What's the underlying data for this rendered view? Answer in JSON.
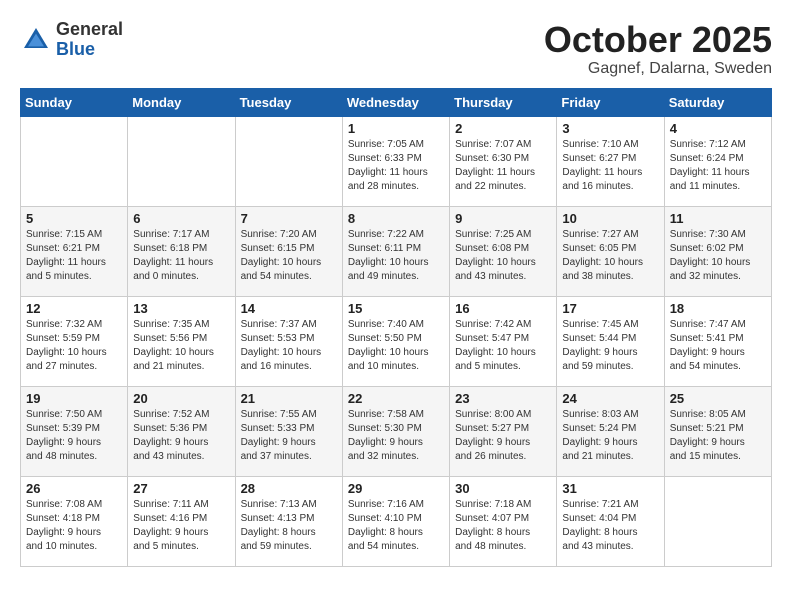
{
  "header": {
    "logo_line1": "General",
    "logo_line2": "Blue",
    "month": "October 2025",
    "location": "Gagnef, Dalarna, Sweden"
  },
  "weekdays": [
    "Sunday",
    "Monday",
    "Tuesday",
    "Wednesday",
    "Thursday",
    "Friday",
    "Saturday"
  ],
  "weeks": [
    [
      {
        "num": "",
        "info": ""
      },
      {
        "num": "",
        "info": ""
      },
      {
        "num": "",
        "info": ""
      },
      {
        "num": "1",
        "info": "Sunrise: 7:05 AM\nSunset: 6:33 PM\nDaylight: 11 hours\nand 28 minutes."
      },
      {
        "num": "2",
        "info": "Sunrise: 7:07 AM\nSunset: 6:30 PM\nDaylight: 11 hours\nand 22 minutes."
      },
      {
        "num": "3",
        "info": "Sunrise: 7:10 AM\nSunset: 6:27 PM\nDaylight: 11 hours\nand 16 minutes."
      },
      {
        "num": "4",
        "info": "Sunrise: 7:12 AM\nSunset: 6:24 PM\nDaylight: 11 hours\nand 11 minutes."
      }
    ],
    [
      {
        "num": "5",
        "info": "Sunrise: 7:15 AM\nSunset: 6:21 PM\nDaylight: 11 hours\nand 5 minutes."
      },
      {
        "num": "6",
        "info": "Sunrise: 7:17 AM\nSunset: 6:18 PM\nDaylight: 11 hours\nand 0 minutes."
      },
      {
        "num": "7",
        "info": "Sunrise: 7:20 AM\nSunset: 6:15 PM\nDaylight: 10 hours\nand 54 minutes."
      },
      {
        "num": "8",
        "info": "Sunrise: 7:22 AM\nSunset: 6:11 PM\nDaylight: 10 hours\nand 49 minutes."
      },
      {
        "num": "9",
        "info": "Sunrise: 7:25 AM\nSunset: 6:08 PM\nDaylight: 10 hours\nand 43 minutes."
      },
      {
        "num": "10",
        "info": "Sunrise: 7:27 AM\nSunset: 6:05 PM\nDaylight: 10 hours\nand 38 minutes."
      },
      {
        "num": "11",
        "info": "Sunrise: 7:30 AM\nSunset: 6:02 PM\nDaylight: 10 hours\nand 32 minutes."
      }
    ],
    [
      {
        "num": "12",
        "info": "Sunrise: 7:32 AM\nSunset: 5:59 PM\nDaylight: 10 hours\nand 27 minutes."
      },
      {
        "num": "13",
        "info": "Sunrise: 7:35 AM\nSunset: 5:56 PM\nDaylight: 10 hours\nand 21 minutes."
      },
      {
        "num": "14",
        "info": "Sunrise: 7:37 AM\nSunset: 5:53 PM\nDaylight: 10 hours\nand 16 minutes."
      },
      {
        "num": "15",
        "info": "Sunrise: 7:40 AM\nSunset: 5:50 PM\nDaylight: 10 hours\nand 10 minutes."
      },
      {
        "num": "16",
        "info": "Sunrise: 7:42 AM\nSunset: 5:47 PM\nDaylight: 10 hours\nand 5 minutes."
      },
      {
        "num": "17",
        "info": "Sunrise: 7:45 AM\nSunset: 5:44 PM\nDaylight: 9 hours\nand 59 minutes."
      },
      {
        "num": "18",
        "info": "Sunrise: 7:47 AM\nSunset: 5:41 PM\nDaylight: 9 hours\nand 54 minutes."
      }
    ],
    [
      {
        "num": "19",
        "info": "Sunrise: 7:50 AM\nSunset: 5:39 PM\nDaylight: 9 hours\nand 48 minutes."
      },
      {
        "num": "20",
        "info": "Sunrise: 7:52 AM\nSunset: 5:36 PM\nDaylight: 9 hours\nand 43 minutes."
      },
      {
        "num": "21",
        "info": "Sunrise: 7:55 AM\nSunset: 5:33 PM\nDaylight: 9 hours\nand 37 minutes."
      },
      {
        "num": "22",
        "info": "Sunrise: 7:58 AM\nSunset: 5:30 PM\nDaylight: 9 hours\nand 32 minutes."
      },
      {
        "num": "23",
        "info": "Sunrise: 8:00 AM\nSunset: 5:27 PM\nDaylight: 9 hours\nand 26 minutes."
      },
      {
        "num": "24",
        "info": "Sunrise: 8:03 AM\nSunset: 5:24 PM\nDaylight: 9 hours\nand 21 minutes."
      },
      {
        "num": "25",
        "info": "Sunrise: 8:05 AM\nSunset: 5:21 PM\nDaylight: 9 hours\nand 15 minutes."
      }
    ],
    [
      {
        "num": "26",
        "info": "Sunrise: 7:08 AM\nSunset: 4:18 PM\nDaylight: 9 hours\nand 10 minutes."
      },
      {
        "num": "27",
        "info": "Sunrise: 7:11 AM\nSunset: 4:16 PM\nDaylight: 9 hours\nand 5 minutes."
      },
      {
        "num": "28",
        "info": "Sunrise: 7:13 AM\nSunset: 4:13 PM\nDaylight: 8 hours\nand 59 minutes."
      },
      {
        "num": "29",
        "info": "Sunrise: 7:16 AM\nSunset: 4:10 PM\nDaylight: 8 hours\nand 54 minutes."
      },
      {
        "num": "30",
        "info": "Sunrise: 7:18 AM\nSunset: 4:07 PM\nDaylight: 8 hours\nand 48 minutes."
      },
      {
        "num": "31",
        "info": "Sunrise: 7:21 AM\nSunset: 4:04 PM\nDaylight: 8 hours\nand 43 minutes."
      },
      {
        "num": "",
        "info": ""
      }
    ]
  ]
}
